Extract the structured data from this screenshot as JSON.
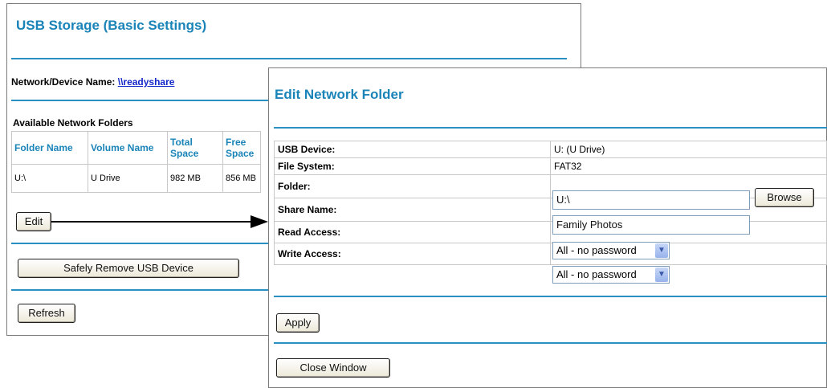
{
  "usb_storage": {
    "title": "USB Storage (Basic Settings)",
    "device_name_label": "Network/Device Name:",
    "device_name_link": "\\\\readyshare",
    "folders_heading": "Available Network Folders",
    "columns": [
      "Folder Name",
      "Volume Name",
      "Total Space",
      "Free Space"
    ],
    "rows": [
      {
        "folder": "U:\\",
        "volume": "U Drive",
        "total": "982 MB",
        "free": "856 MB"
      }
    ],
    "edit_label": "Edit",
    "safely_remove_label": "Safely Remove USB Device",
    "refresh_label": "Refresh"
  },
  "edit_folder": {
    "title": "Edit Network Folder",
    "usb_device_label": "USB Device:",
    "usb_device_value": "U: (U Drive)",
    "file_system_label": "File System:",
    "file_system_value": "FAT32",
    "folder_label": "Folder:",
    "folder_value": "U:\\",
    "browse_label": "Browse",
    "share_name_label": "Share Name:",
    "share_name_value": "Family Photos",
    "read_access_label": "Read Access:",
    "read_access_value": "All - no password",
    "write_access_label": "Write Access:",
    "write_access_value": "All - no password",
    "apply_label": "Apply",
    "close_label": "Close Window"
  },
  "colors": {
    "accent": "#1a84b8",
    "rule": "#2a8fc1",
    "link": "#1428c8"
  }
}
